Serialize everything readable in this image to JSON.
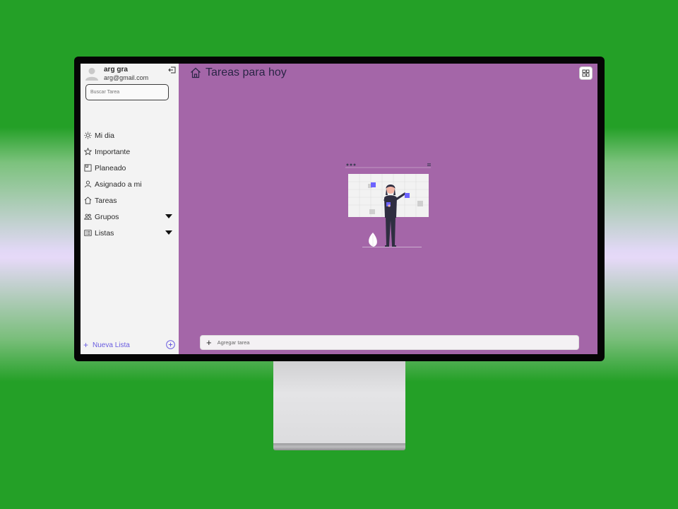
{
  "user": {
    "name": "arg gra",
    "email": "arg@gmail.com"
  },
  "search": {
    "placeholder": "Buscar Tarea"
  },
  "nav": {
    "items": [
      {
        "label": "Mi dia",
        "icon": "sun-icon"
      },
      {
        "label": "Importante",
        "icon": "star-icon"
      },
      {
        "label": "Planeado",
        "icon": "calendar-icon"
      },
      {
        "label": "Asignado a mi",
        "icon": "person-icon"
      },
      {
        "label": "Tareas",
        "icon": "home-icon"
      },
      {
        "label": "Grupos",
        "icon": "group-icon",
        "expandable": true
      },
      {
        "label": "Listas",
        "icon": "list-icon",
        "expandable": true
      }
    ]
  },
  "footer": {
    "new_list_label": "Nueva Lista"
  },
  "main": {
    "title": "Tareas para hoy",
    "add_task_placeholder": "Agregar tarea"
  },
  "colors": {
    "screen_bg": "#a466a8",
    "sidebar_bg": "#f3f3f3",
    "accent": "#6a5de0",
    "backdrop": "#24a027"
  }
}
